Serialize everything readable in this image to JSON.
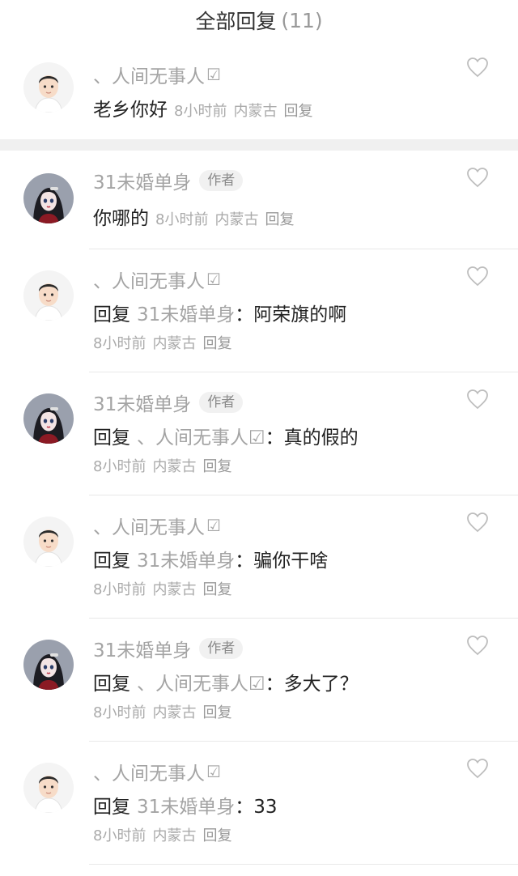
{
  "header": {
    "title": "全部回复",
    "count": "(11)"
  },
  "top_comment": {
    "author": "、人间无事人",
    "verify": "☑",
    "text": "老乡你好",
    "time": "8小时前",
    "location": "内蒙古",
    "action": "回复"
  },
  "replies": [
    {
      "author": "31未婚单身",
      "badge": "作者",
      "prefix": "",
      "target": "",
      "colon": "",
      "text": "你哪的",
      "time": "8小时前",
      "location": "内蒙古",
      "action": "回复"
    },
    {
      "author": "、人间无事人",
      "verify": "☑",
      "prefix": "回复",
      "target": "31未婚单身",
      "colon": "：",
      "text": "阿荣旗的啊",
      "time": "8小时前",
      "location": "内蒙古",
      "action": "回复"
    },
    {
      "author": "31未婚单身",
      "badge": "作者",
      "prefix": "回复",
      "target": "、人间无事人☑",
      "colon": "：",
      "text": "真的假的",
      "time": "8小时前",
      "location": "内蒙古",
      "action": "回复"
    },
    {
      "author": "、人间无事人",
      "verify": "☑",
      "prefix": "回复",
      "target": "31未婚单身",
      "colon": "：",
      "text": "骗你干啥",
      "time": "8小时前",
      "location": "内蒙古",
      "action": "回复"
    },
    {
      "author": "31未婚单身",
      "badge": "作者",
      "prefix": "回复",
      "target": "、人间无事人☑",
      "colon": "：",
      "text": "多大了？",
      "time": "8小时前",
      "location": "内蒙古",
      "action": "回复"
    },
    {
      "author": "、人间无事人",
      "verify": "☑",
      "prefix": "回复",
      "target": "31未婚单身",
      "colon": "：",
      "text": "33",
      "time": "8小时前",
      "location": "内蒙古",
      "action": "回复"
    }
  ],
  "icons": {
    "like": "heart-outline-icon",
    "verify": "checkbox-icon"
  },
  "colors": {
    "muted": "#a4a4a4",
    "text": "#222222",
    "separator": "#f0f0f0"
  }
}
